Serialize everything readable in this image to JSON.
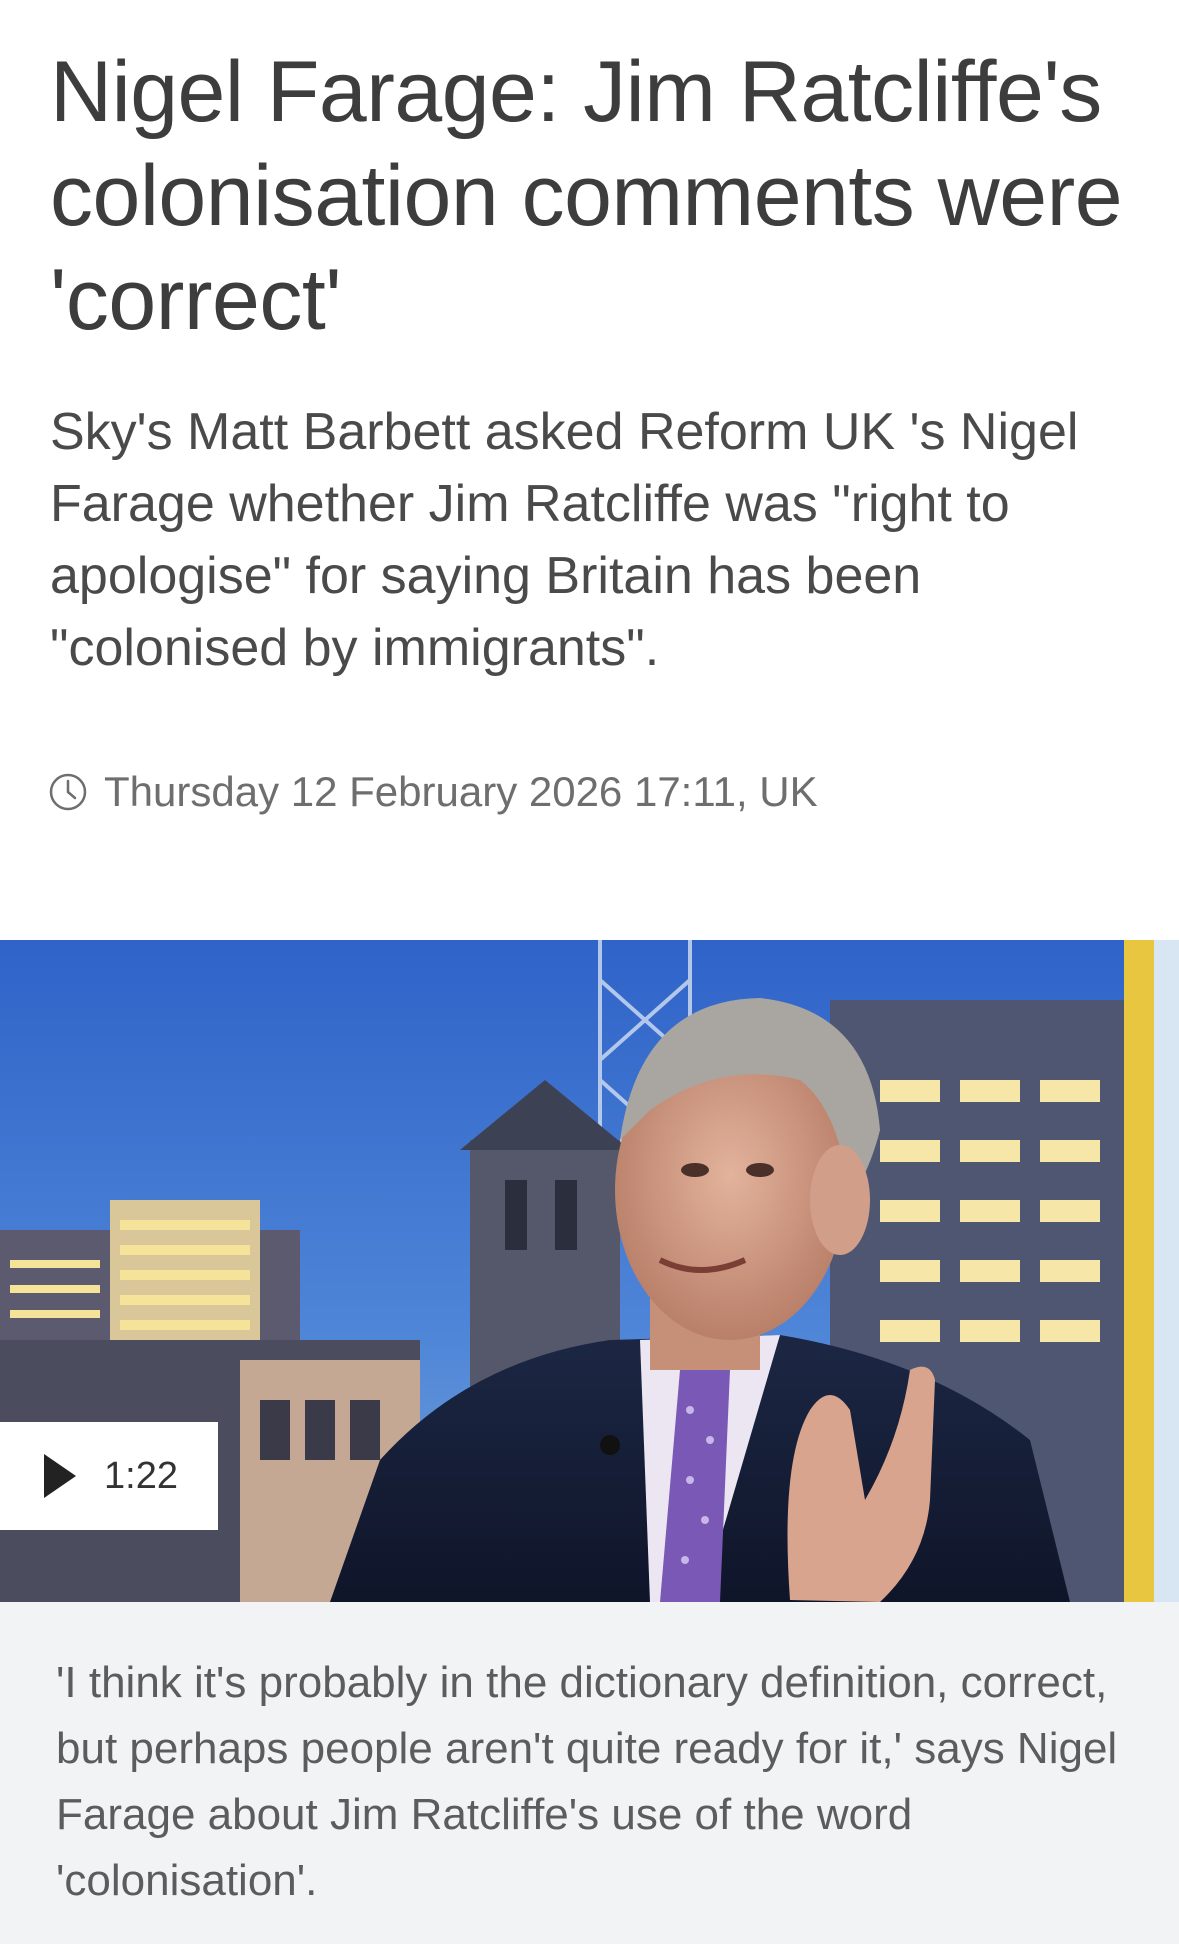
{
  "article": {
    "headline": "Nigel Farage: Jim Ratcliffe's colonisation comments were 'correct'",
    "standfirst": "Sky's Matt Barbett asked Reform UK 's Nigel Farage whether Jim Ratcliffe was \"right to apologise\" for saying Britain has been \"colonised by immigrants\".",
    "timestamp": "Thursday 12 February 2026 17:11, UK",
    "timestamp_icon": "clock-icon"
  },
  "video": {
    "duration": "1:22",
    "play_icon": "play-icon"
  },
  "caption": {
    "text": "'I think it's probably in the dictionary definition, correct, but perhaps people aren't quite ready for it,' says Nigel Farage about Jim Ratcliffe's use of the word 'colonisation'."
  },
  "colors": {
    "caption_background": "#f2f3f5",
    "headline_text": "#3d3d3d",
    "meta_text": "#6e6e6e"
  }
}
